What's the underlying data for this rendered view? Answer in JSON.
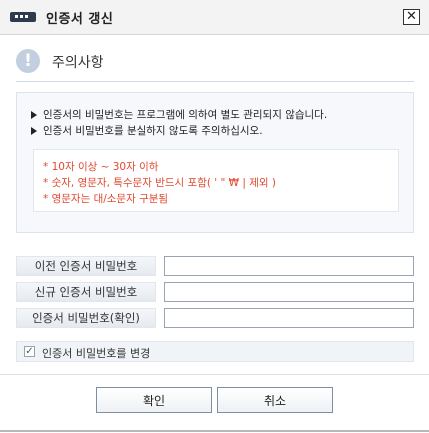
{
  "window": {
    "title": "인증서 갱신",
    "close_icon": "close-icon",
    "close_glyph": "✕"
  },
  "notice": {
    "icon": "exclamation-icon",
    "icon_glyph": "!",
    "title": "주의사항",
    "lines": [
      "인증서의 비밀번호는 프로그램에 의하여 별도 관리되지 않습니다.",
      "인증서 비밀번호를 분실하지 않도록 주의하십시오."
    ],
    "rules": [
      "* 10자 이상 ~ 30자 이하",
      "* 숫자, 영문자, 특수문자 반드시 포함( ' \" ₩ | 제외 )",
      "* 영문자는 대/소문자 구분됨"
    ]
  },
  "form": {
    "old_password_label": "이전 인증서 비밀번호",
    "old_password_value": "",
    "new_password_label": "신규 인증서 비밀번호",
    "new_password_value": "",
    "confirm_password_label": "인증서 비밀번호(확인)",
    "confirm_password_value": "",
    "change_password_label": "인증서 비밀번호를 변경",
    "change_password_checked": true,
    "check_glyph": "✓"
  },
  "buttons": {
    "ok_label": "확인",
    "cancel_label": "취소"
  },
  "colors": {
    "accent_red": "#e0492f",
    "title_icon": "#2e3a4e",
    "notice_icon": "#c2cfdf"
  }
}
